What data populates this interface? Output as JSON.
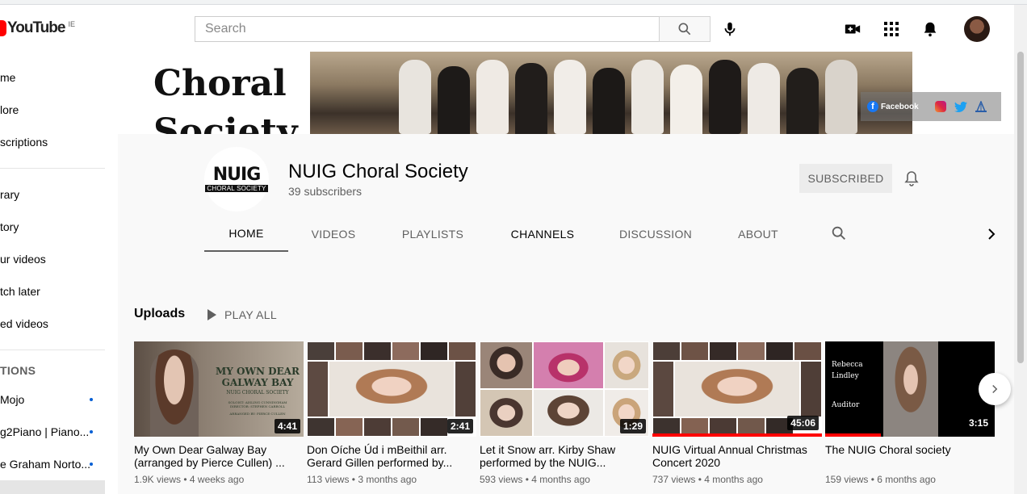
{
  "masthead": {
    "logo_text": "YouTube",
    "country_code": "IE",
    "search_placeholder": "Search"
  },
  "sidebar": {
    "items": [
      {
        "label": "me"
      },
      {
        "label": "lore"
      },
      {
        "label": "scriptions"
      },
      {
        "label": "rary"
      },
      {
        "label": "tory"
      },
      {
        "label": "ur videos"
      },
      {
        "label": "tch later"
      },
      {
        "label": "ed videos"
      }
    ],
    "section_title": "TIONS",
    "subscriptions": [
      {
        "label": "Mojo"
      },
      {
        "label": "g2Piano | Piano..."
      },
      {
        "label": "e Graham Norto..."
      }
    ]
  },
  "banner": {
    "word_line1": "Choral",
    "word_line2": "Society",
    "facebook_label": "Facebook"
  },
  "channel": {
    "logo_top": "NUIG",
    "logo_bottom": "CHORAL SOCIETY",
    "name": "NUIG Choral Society",
    "subscribers": "39 subscribers",
    "subscribe_label": "SUBSCRIBED"
  },
  "tabs": [
    {
      "label": "HOME"
    },
    {
      "label": "VIDEOS"
    },
    {
      "label": "PLAYLISTS"
    },
    {
      "label": "CHANNELS"
    },
    {
      "label": "DISCUSSION"
    },
    {
      "label": "ABOUT"
    }
  ],
  "uploads": {
    "title": "Uploads",
    "play_all": "PLAY ALL",
    "videos": [
      {
        "title": "My Own Dear Galway Bay (arranged by Pierce Cullen) ...",
        "meta": "1.9K views • 4 weeks ago",
        "duration": "4:41",
        "thumb_title_1": "MY OWN DEAR",
        "thumb_title_2": "GALWAY BAY",
        "thumb_title_3": "NUIG CHORAL SOCIETY",
        "thumb_credit_1": "SOLOIST: AISLING CUNNINGHAM",
        "thumb_credit_2": "DIRECTOR: STEPHEN CARROLL",
        "thumb_credit_3": "ARRANGED BY: PIERCE CULLEN"
      },
      {
        "title": "Don Oíche Úd i mBeithil arr. Gerard Gillen performed by...",
        "meta": "113 views • 3 months ago",
        "duration": "2:41"
      },
      {
        "title": "Let it Snow arr. Kirby Shaw performed by the NUIG...",
        "meta": "593 views • 4 months ago",
        "duration": "1:29"
      },
      {
        "title": "NUIG Virtual Annual Christmas Concert 2020",
        "meta": "737 views • 4 months ago",
        "duration": "45:06",
        "watched_fraction": 1.0
      },
      {
        "title": "The NUIG Choral society",
        "meta": "159 views • 6 months ago",
        "duration": "3:15",
        "watched_fraction": 0.33,
        "thumb_name_1": "Rebecca",
        "thumb_name_2": "Lindley",
        "thumb_role": "Auditor"
      }
    ]
  }
}
